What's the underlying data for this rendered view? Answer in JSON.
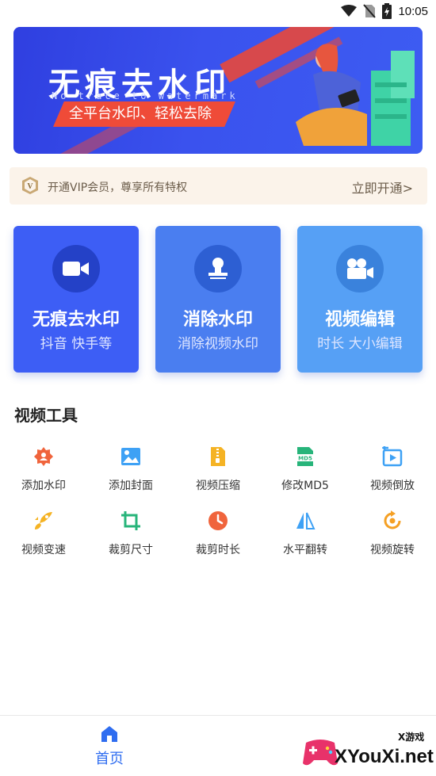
{
  "status_bar": {
    "time": "10:05"
  },
  "banner": {
    "title": "无痕去水印",
    "subtitle": "No trace to watermark",
    "tagline": "全平台水印、轻松去除"
  },
  "vip": {
    "text": "开通VIP会员，尊享所有特权",
    "action": "立即开通>",
    "badge_letter": "V"
  },
  "cards": [
    {
      "title": "无痕去水印",
      "subtitle": "抖音 快手等",
      "icon": "video-camera-icon",
      "color": "#3d5ef5"
    },
    {
      "title": "消除水印",
      "subtitle": "消除视频水印",
      "icon": "stamp-icon",
      "color": "#4a7ef0"
    },
    {
      "title": "视频编辑",
      "subtitle": "时长 大小编辑",
      "icon": "movie-camera-icon",
      "color": "#56a0f5"
    }
  ],
  "section": {
    "title": "视频工具"
  },
  "tools": [
    {
      "label": "添加水印",
      "icon": "add-watermark-icon",
      "color": "#f0643c"
    },
    {
      "label": "添加封面",
      "icon": "image-icon",
      "color": "#3ea1f5"
    },
    {
      "label": "视频压缩",
      "icon": "zip-file-icon",
      "color": "#f5b324"
    },
    {
      "label": "修改MD5",
      "icon": "md5-file-icon",
      "color": "#27b47a"
    },
    {
      "label": "视频倒放",
      "icon": "reverse-play-icon",
      "color": "#3ea1f5"
    },
    {
      "label": "视频变速",
      "icon": "rocket-icon",
      "color": "#f5b324"
    },
    {
      "label": "裁剪尺寸",
      "icon": "crop-icon",
      "color": "#27b47a"
    },
    {
      "label": "裁剪时长",
      "icon": "clock-icon",
      "color": "#f0643c"
    },
    {
      "label": "水平翻转",
      "icon": "flip-horizontal-icon",
      "color": "#3ea1f5"
    },
    {
      "label": "视频旋转",
      "icon": "rotate-icon",
      "color": "#f5a024"
    }
  ],
  "bottom_nav": {
    "home_label": "首页",
    "watermark_text": "XYouXi.net",
    "watermark_badge": "X游戏"
  }
}
